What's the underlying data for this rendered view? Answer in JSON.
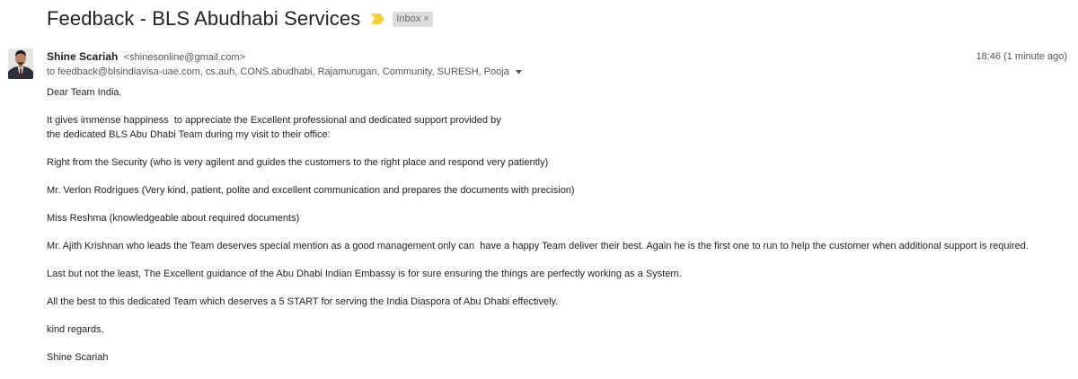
{
  "subject": "Feedback - BLS Abudhabi Services",
  "label": {
    "text": "Inbox",
    "remove_glyph": "×"
  },
  "importance_color": "#f4d03f",
  "sender": {
    "name": "Shine Scariah",
    "email": "<shinesonline@gmail.com>"
  },
  "recipients": "to feedback@blsindiavisa-uae.com, cs.auh, CONS.abudhabi, Rajamurugan, Community, SURESH, Pooja",
  "timestamp": "18:46 (1 minute ago)",
  "body": {
    "greeting": "Dear Team India.",
    "para1_line1": "It gives immense happiness  to appreciate the Excellent professional and dedicated support provided by",
    "para1_line2": "the dedicated BLS Abu Dhabi Team during my visit to their office:",
    "para2": "Right from the Security (who is very agilent and guides the customers to the right place and respond very patiently)",
    "para3": "Mr. Verlon Rodrigues (Very kind, patient, polite and excellent communication and prepares the documents with precision)",
    "para4": "Miss Reshma (knowledgeable about required documents)",
    "para5": "Mr. Ajith Krishnan who leads the Team deserves special mention as a good management only can  have a happy Team deliver their best. Again he is the first one to run to help the customer when additional support is required.",
    "para6": "Last but not the least, The Excellent guidance of the Abu Dhabi Indian Embassy is for sure ensuring the things are perfectly working as a System.",
    "para7": "All the best to this dedicated Team which deserves a 5 START for serving the India Diaspora of Abu Dhabi effectively.",
    "closing": "kind regards,",
    "signature": "Shine Scariah"
  }
}
